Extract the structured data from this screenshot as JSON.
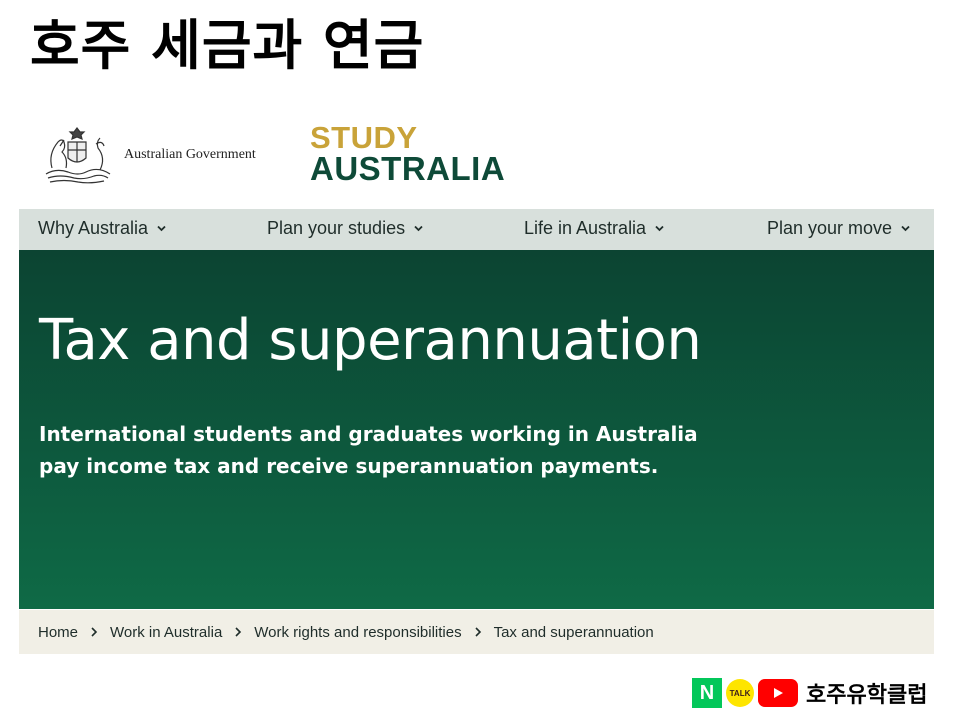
{
  "slide": {
    "title": "호주 세금과 연금"
  },
  "header": {
    "gov_logo_text": "Australian Government",
    "brand_line1": "STUDY",
    "brand_line2": "AUSTRALIA"
  },
  "nav": {
    "items": [
      {
        "label": "Why Australia"
      },
      {
        "label": "Plan your studies"
      },
      {
        "label": "Life in Australia"
      },
      {
        "label": "Plan your move"
      }
    ]
  },
  "hero": {
    "title": "Tax and superannuation",
    "description": "International students and graduates working in Australia pay income tax and receive superannuation payments."
  },
  "breadcrumb": {
    "items": [
      "Home",
      "Work in Australia",
      "Work rights and responsibilities",
      "Tax and superannuation"
    ]
  },
  "channel": {
    "naver_letter": "N",
    "talk_label": "TALK",
    "name": "호주유학클럽"
  },
  "colors": {
    "brand_gold": "#c9a339",
    "brand_green": "#0e4a38",
    "nav_bg": "#d8e0dc",
    "hero_bg": "#0d5a3e",
    "breadcrumb_bg": "#f1efe6"
  },
  "icons": {
    "crest": "coat-of-arms-icon",
    "nav_chevron": "chevron-down-icon",
    "breadcrumb_separator": "chevron-right-icon",
    "youtube": "youtube-play-icon"
  }
}
